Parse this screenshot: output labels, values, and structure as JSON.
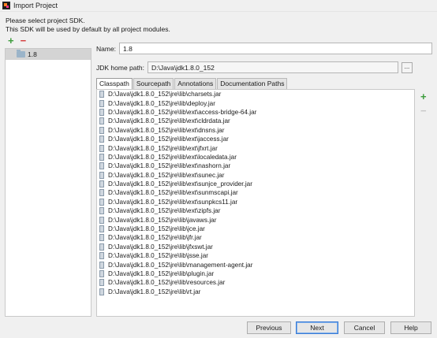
{
  "window": {
    "title": "Import Project",
    "icon": "intellij-app-icon"
  },
  "header": {
    "line1": "Please select project SDK.",
    "line2": "This SDK will be used by default by all project modules."
  },
  "sdk_list": {
    "add_icon": "plus-icon",
    "remove_icon": "minus-icon",
    "items": [
      {
        "label": "1.8",
        "icon": "jdk-folder-icon"
      }
    ]
  },
  "form": {
    "name_label": "Name:",
    "name_value": "1.8",
    "home_label": "JDK home path:",
    "home_value": "D:\\Java\\jdk1.8.0_152",
    "browse_label": "..."
  },
  "tabs": [
    {
      "label": "Classpath",
      "active": true
    },
    {
      "label": "Sourcepath",
      "active": false
    },
    {
      "label": "Annotations",
      "active": false
    },
    {
      "label": "Documentation Paths",
      "active": false
    }
  ],
  "classpath": [
    "D:\\Java\\jdk1.8.0_152\\jre\\lib\\charsets.jar",
    "D:\\Java\\jdk1.8.0_152\\jre\\lib\\deploy.jar",
    "D:\\Java\\jdk1.8.0_152\\jre\\lib\\ext\\access-bridge-64.jar",
    "D:\\Java\\jdk1.8.0_152\\jre\\lib\\ext\\cldrdata.jar",
    "D:\\Java\\jdk1.8.0_152\\jre\\lib\\ext\\dnsns.jar",
    "D:\\Java\\jdk1.8.0_152\\jre\\lib\\ext\\jaccess.jar",
    "D:\\Java\\jdk1.8.0_152\\jre\\lib\\ext\\jfxrt.jar",
    "D:\\Java\\jdk1.8.0_152\\jre\\lib\\ext\\localedata.jar",
    "D:\\Java\\jdk1.8.0_152\\jre\\lib\\ext\\nashorn.jar",
    "D:\\Java\\jdk1.8.0_152\\jre\\lib\\ext\\sunec.jar",
    "D:\\Java\\jdk1.8.0_152\\jre\\lib\\ext\\sunjce_provider.jar",
    "D:\\Java\\jdk1.8.0_152\\jre\\lib\\ext\\sunmscapi.jar",
    "D:\\Java\\jdk1.8.0_152\\jre\\lib\\ext\\sunpkcs11.jar",
    "D:\\Java\\jdk1.8.0_152\\jre\\lib\\ext\\zipfs.jar",
    "D:\\Java\\jdk1.8.0_152\\jre\\lib\\javaws.jar",
    "D:\\Java\\jdk1.8.0_152\\jre\\lib\\jce.jar",
    "D:\\Java\\jdk1.8.0_152\\jre\\lib\\jfr.jar",
    "D:\\Java\\jdk1.8.0_152\\jre\\lib\\jfxswt.jar",
    "D:\\Java\\jdk1.8.0_152\\jre\\lib\\jsse.jar",
    "D:\\Java\\jdk1.8.0_152\\jre\\lib\\management-agent.jar",
    "D:\\Java\\jdk1.8.0_152\\jre\\lib\\plugin.jar",
    "D:\\Java\\jdk1.8.0_152\\jre\\lib\\resources.jar",
    "D:\\Java\\jdk1.8.0_152\\jre\\lib\\rt.jar"
  ],
  "footer": {
    "previous": "Previous",
    "next": "Next",
    "cancel": "Cancel",
    "help": "Help"
  },
  "colors": {
    "add": "#3c9c3c",
    "remove": "#d43b3b",
    "default_button_border": "#3a7bd5"
  }
}
